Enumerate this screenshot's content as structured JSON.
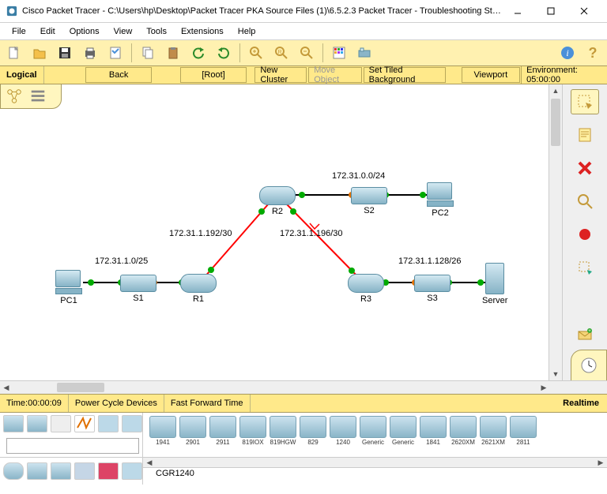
{
  "window": {
    "title": "Cisco Packet Tracer - C:\\Users\\hp\\Desktop\\Packet Tracer PKA Source Files (1)\\6.5.2.3 Packet Tracer - Troubleshooting Sta..."
  },
  "menu": {
    "items": [
      "File",
      "Edit",
      "Options",
      "View",
      "Tools",
      "Extensions",
      "Help"
    ]
  },
  "subbar": {
    "mode": "Logical",
    "back": "Back",
    "root": "[Root]",
    "new_cluster": "New Cluster",
    "move_object": "Move Object",
    "tiled_bg": "Set Tiled Background",
    "viewport": "Viewport",
    "env": "Environment: 05:00:00"
  },
  "status": {
    "time_label": "Time: ",
    "time_value": "00:00:09",
    "power_cycle": "Power Cycle Devices",
    "fast_forward": "Fast Forward Time",
    "realtime": "Realtime"
  },
  "devices": {
    "list": [
      "1941",
      "2901",
      "2911",
      "819IOX",
      "819HGW",
      "829",
      "1240",
      "Generic",
      "Generic",
      "1841",
      "2620XM",
      "2621XM",
      "2811"
    ],
    "selected": "CGR1240"
  },
  "topology": {
    "nodes": {
      "pc1": "PC1",
      "s1": "S1",
      "r1": "R1",
      "r2": "R2",
      "r3": "R3",
      "s2": "S2",
      "s3": "S3",
      "pc2": "PC2",
      "server": "Server"
    },
    "subnets": {
      "pc1_s1": "172.31.1.0/25",
      "r1_r2": "172.31.1.192/30",
      "r2_r3": "172.31.1.196/30",
      "r2_s2": "172.31.0.0/24",
      "r3_s3": "172.31.1.128/26"
    }
  }
}
